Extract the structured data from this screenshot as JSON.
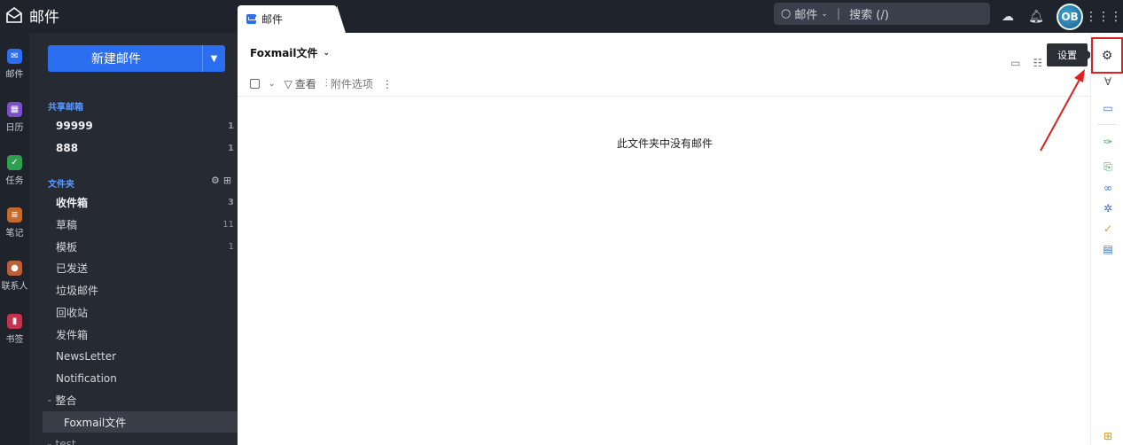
{
  "app": {
    "title": "邮件",
    "tab_label": "邮件"
  },
  "search": {
    "scope": "邮件",
    "placeholder": "搜索 (/)"
  },
  "rail": [
    {
      "label": "邮件",
      "icon": "mail-icon",
      "color": "#2b6ef0"
    },
    {
      "label": "日历",
      "icon": "calendar-icon",
      "color": "#7a4fc9"
    },
    {
      "label": "任务",
      "icon": "task-icon",
      "color": "#2e9f4f"
    },
    {
      "label": "笔记",
      "icon": "note-icon",
      "color": "#c26b2c"
    },
    {
      "label": "联系人",
      "icon": "contact-icon",
      "color": "#b9603a"
    },
    {
      "label": "书签",
      "icon": "bookmark-icon",
      "color": "#c2334d"
    }
  ],
  "compose": {
    "label": "新建邮件"
  },
  "shared": {
    "heading": "共享邮箱",
    "items": [
      {
        "name": "99999",
        "count": "1"
      },
      {
        "name": "888",
        "count": "1"
      }
    ]
  },
  "folders": {
    "heading": "文件夹",
    "items": [
      {
        "name": "收件箱",
        "count": "3"
      },
      {
        "name": "草稿",
        "count": "11"
      },
      {
        "name": "模板",
        "count": "1"
      },
      {
        "name": "已发送",
        "count": ""
      },
      {
        "name": "垃圾邮件",
        "count": ""
      },
      {
        "name": "回收站",
        "count": ""
      },
      {
        "name": "发件箱",
        "count": ""
      },
      {
        "name": "NewsLetter",
        "count": ""
      },
      {
        "name": "Notification",
        "count": ""
      },
      {
        "name": "整合",
        "count": ""
      },
      {
        "name": "Foxmail文件",
        "count": ""
      },
      {
        "name": "test",
        "count": ""
      }
    ]
  },
  "main": {
    "folder_title": "Foxmail文件",
    "view_label": "查看",
    "attach_label": "附件选项",
    "empty_text": "此文件夹中没有邮件"
  },
  "tooltip": {
    "settings": "设置"
  },
  "colors": {
    "accent": "#2b6ef0",
    "highlight": "#e02020",
    "dark_bg": "#1f232c"
  }
}
